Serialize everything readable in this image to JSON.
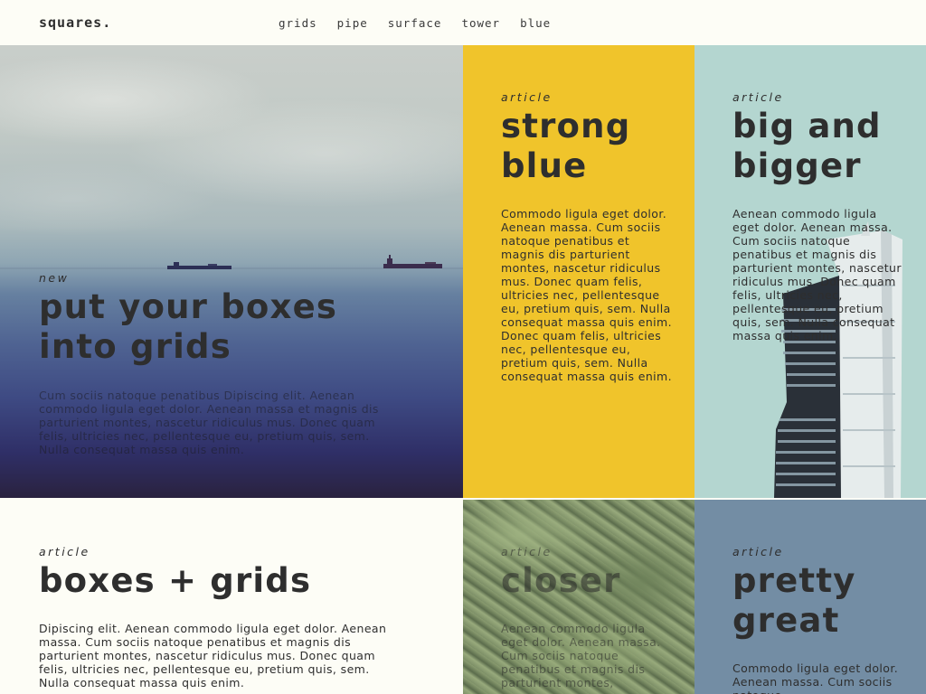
{
  "header": {
    "logo": "squares.",
    "nav": [
      "grids",
      "pipe",
      "surface",
      "tower",
      "blue"
    ]
  },
  "tiles": {
    "hero": {
      "kicker": "new",
      "title": "put your boxes into grids",
      "body": "Cum sociis natoque penatibus Dipiscing elit. Aenean commodo ligula eget dolor. Aenean massa et magnis dis parturient montes, nascetur ridiculus mus. Donec quam felis, ultricies nec, pellentesque eu, pretium quis, sem. Nulla consequat massa quis enim."
    },
    "yellow": {
      "kicker": "article",
      "title": "strong blue",
      "body": "Commodo ligula eget dolor. Aenean massa. Cum sociis natoque penatibus et magnis dis parturient montes, nascetur ridiculus mus. Donec quam felis, ultricies nec, pellentesque eu, pretium quis, sem. Nulla consequat massa quis enim.  Donec quam felis, ultricies nec, pellentesque eu, pretium quis, sem. Nulla consequat massa quis enim."
    },
    "tower": {
      "kicker": "article",
      "title": "big and bigger",
      "body": "Aenean commodo ligula eget dolor. Aenean massa. Cum sociis natoque penatibus et magnis dis parturient montes, nascetur ridiculus mus. Donec quam felis, ultricies nec, pellentesque eu, pretium quis, sem. Nulla consequat massa quis enim."
    },
    "boxes": {
      "kicker": "article",
      "title": "boxes + grids",
      "body": "Dipiscing elit. Aenean commodo ligula eget dolor. Aenean massa. Cum sociis natoque penatibus et magnis dis parturient montes, nascetur ridiculus mus. Donec quam felis, ultricies nec, pellentesque eu, pretium quis, sem. Nulla consequat massa quis enim."
    },
    "closer": {
      "kicker": "article",
      "title": "closer",
      "body": "Aenean commodo ligula eget dolor. Aenean massa. Cum sociis natoque penatibus et magnis dis parturient montes,"
    },
    "slate": {
      "kicker": "article",
      "title": "pretty great",
      "body": "Commodo ligula eget dolor. Aenean massa. Cum sociis natoque"
    }
  },
  "colors": {
    "background": "#fdfdf6",
    "yellow": "#f0c42b",
    "mint": "#b4d6d0",
    "slate": "#738da4",
    "text": "#2e2e2e"
  }
}
